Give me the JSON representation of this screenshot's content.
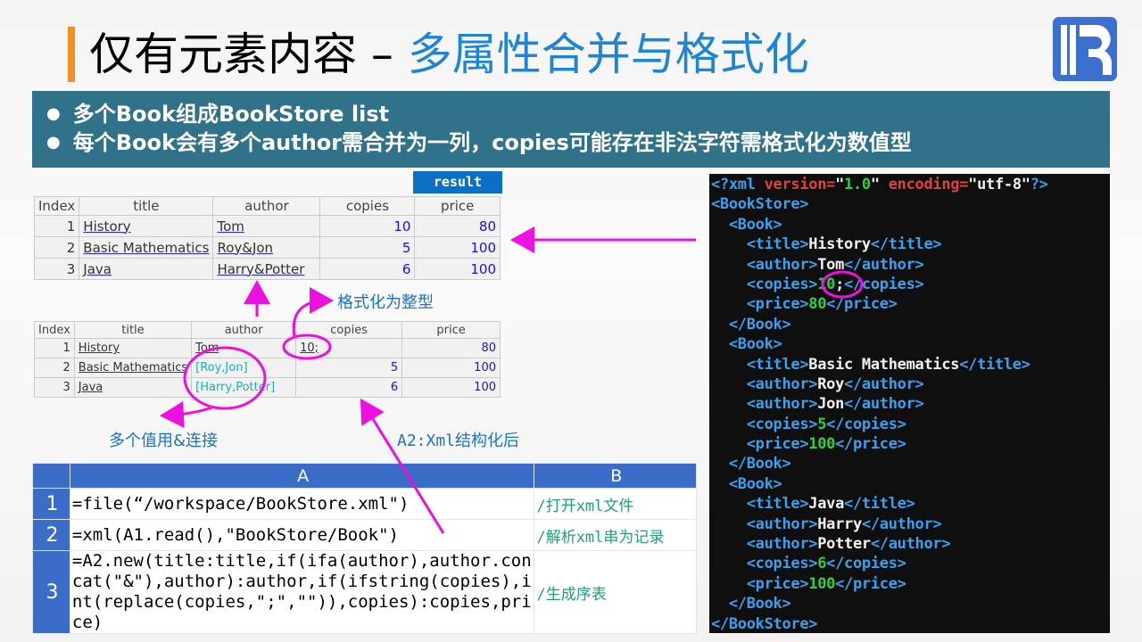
{
  "title": {
    "part1": "仅有元素内容 – ",
    "part2": "多属性合并与格式化"
  },
  "banner": [
    "多个Book组成BookStore list",
    "每个Book会有多个author需合并为一列，copies可能存在非法字符需格式化为数值型"
  ],
  "result_label": "result",
  "result_table": {
    "headers": [
      "Index",
      "title",
      "author",
      "copies",
      "price"
    ],
    "rows": [
      [
        "1",
        "History",
        "Tom",
        "10",
        "80"
      ],
      [
        "2",
        "Basic Mathematics",
        "Roy&Jon",
        "5",
        "100"
      ],
      [
        "3",
        "Java",
        "Harry&Potter",
        "6",
        "100"
      ]
    ]
  },
  "raw_table": {
    "headers": [
      "Index",
      "title",
      "author",
      "copies",
      "price"
    ],
    "rows": [
      [
        "1",
        "History",
        "Tom",
        "10;",
        "80"
      ],
      [
        "2",
        "Basic Mathematics",
        "[Roy,Jon]",
        "5",
        "100"
      ],
      [
        "3",
        "Java",
        "[Harry,Potter]",
        "6",
        "100"
      ]
    ]
  },
  "annotations": {
    "format_int": "格式化为整型",
    "concat": "多个值用&连接",
    "structured": "A2:Xml结构化后"
  },
  "grid": {
    "col_headers": [
      "A",
      "B"
    ],
    "rows": [
      {
        "n": "1",
        "a": "=file(“/workspace/BookStore.xml\")",
        "b": "/打开xml文件"
      },
      {
        "n": "2",
        "a": "=xml(A1.read(),\"BookStore/Book\")",
        "b": "/解析xml串为记录"
      },
      {
        "n": "3",
        "a": "=A2.new(title:title,if(ifa(author),author.concat(\"&\"),author):author,if(ifstring(copies),int(replace(copies,\";\",\"\")),copies):copies,price)",
        "b": "/生成序表"
      }
    ]
  },
  "xml_lines": [
    [
      [
        "tg",
        "<?xml "
      ],
      [
        "at",
        "version="
      ],
      [
        "st",
        "\""
      ],
      [
        "nm",
        "1.0"
      ],
      [
        "st",
        "\" "
      ],
      [
        "at",
        "encoding="
      ],
      [
        "st",
        "\"utf-8\""
      ],
      [
        "tg",
        "?>"
      ]
    ],
    [
      [
        "tg",
        "<BookStore>"
      ]
    ],
    [
      [
        "tx",
        "  "
      ],
      [
        "tg",
        "<Book>"
      ]
    ],
    [
      [
        "tx",
        "    "
      ],
      [
        "tg",
        "<title>"
      ],
      [
        "tx",
        "History"
      ],
      [
        "tg",
        "</title>"
      ]
    ],
    [
      [
        "tx",
        "    "
      ],
      [
        "tg",
        "<author>"
      ],
      [
        "tx",
        "Tom"
      ],
      [
        "tg",
        "</author>"
      ]
    ],
    [
      [
        "tx",
        "    "
      ],
      [
        "tg",
        "<copies>"
      ],
      [
        "nm",
        "10"
      ],
      [
        "tx",
        ";"
      ],
      [
        "tg",
        "</copies>"
      ]
    ],
    [
      [
        "tx",
        "    "
      ],
      [
        "tg",
        "<price>"
      ],
      [
        "nm",
        "80"
      ],
      [
        "tg",
        "</price>"
      ]
    ],
    [
      [
        "tx",
        "  "
      ],
      [
        "tg",
        "</Book>"
      ]
    ],
    [
      [
        "tx",
        "  "
      ],
      [
        "tg",
        "<Book>"
      ]
    ],
    [
      [
        "tx",
        "    "
      ],
      [
        "tg",
        "<title>"
      ],
      [
        "tx",
        "Basic Mathematics"
      ],
      [
        "tg",
        "</title>"
      ]
    ],
    [
      [
        "tx",
        "    "
      ],
      [
        "tg",
        "<author>"
      ],
      [
        "tx",
        "Roy"
      ],
      [
        "tg",
        "</author>"
      ]
    ],
    [
      [
        "tx",
        "    "
      ],
      [
        "tg",
        "<author>"
      ],
      [
        "tx",
        "Jon"
      ],
      [
        "tg",
        "</author>"
      ]
    ],
    [
      [
        "tx",
        "    "
      ],
      [
        "tg",
        "<copies>"
      ],
      [
        "nm",
        "5"
      ],
      [
        "tg",
        "</copies>"
      ]
    ],
    [
      [
        "tx",
        "    "
      ],
      [
        "tg",
        "<price>"
      ],
      [
        "nm",
        "100"
      ],
      [
        "tg",
        "</price>"
      ]
    ],
    [
      [
        "tx",
        "  "
      ],
      [
        "tg",
        "</Book>"
      ]
    ],
    [
      [
        "tx",
        "  "
      ],
      [
        "tg",
        "<Book>"
      ]
    ],
    [
      [
        "tx",
        "    "
      ],
      [
        "tg",
        "<title>"
      ],
      [
        "tx",
        "Java"
      ],
      [
        "tg",
        "</title>"
      ]
    ],
    [
      [
        "tx",
        "    "
      ],
      [
        "tg",
        "<author>"
      ],
      [
        "tx",
        "Harry"
      ],
      [
        "tg",
        "</author>"
      ]
    ],
    [
      [
        "tx",
        "    "
      ],
      [
        "tg",
        "<author>"
      ],
      [
        "tx",
        "Potter"
      ],
      [
        "tg",
        "</author>"
      ]
    ],
    [
      [
        "tx",
        "    "
      ],
      [
        "tg",
        "<copies>"
      ],
      [
        "nm",
        "6"
      ],
      [
        "tg",
        "</copies>"
      ]
    ],
    [
      [
        "tx",
        "    "
      ],
      [
        "tg",
        "<price>"
      ],
      [
        "nm",
        "100"
      ],
      [
        "tg",
        "</price>"
      ]
    ],
    [
      [
        "tx",
        "  "
      ],
      [
        "tg",
        "</Book>"
      ]
    ],
    [
      [
        "tg",
        "</BookStore>"
      ]
    ]
  ],
  "colors": {
    "accent": "#f0901e",
    "title_blue": "#1e84d6",
    "banner": "#2f7289",
    "annotation": "#ee10e0",
    "grid_header": "#3a6cc8"
  }
}
